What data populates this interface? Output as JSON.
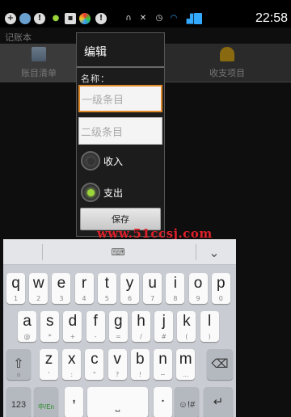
{
  "status_bar": {
    "time": "22:58",
    "icons": [
      "add-icon",
      "globe-icon",
      "alert-icon",
      "android-icon",
      "message-icon",
      "sync-icon",
      "alert-icon",
      "headphones-icon",
      "mute-icon",
      "alarm-icon",
      "wifi-icon",
      "signal-icon",
      "battery-icon"
    ]
  },
  "app": {
    "title": "记账本",
    "tabs": [
      {
        "label": "账目清单",
        "icon": "calculator-icon"
      },
      {
        "label": "收支项目",
        "icon": "money-bag-icon"
      }
    ]
  },
  "dialog": {
    "title": "编辑",
    "name_label": "名称：",
    "level1_placeholder": "一级条目",
    "level2_placeholder": "二级条目",
    "radio_income": "收入",
    "radio_expense": "支出",
    "selected": "支出",
    "save_label": "保存"
  },
  "watermark": "www.51ccsj.com",
  "keyboard": {
    "row1": [
      {
        "main": "q",
        "sub": "1"
      },
      {
        "main": "w",
        "sub": "2"
      },
      {
        "main": "e",
        "sub": "3"
      },
      {
        "main": "r",
        "sub": "4"
      },
      {
        "main": "t",
        "sub": "5"
      },
      {
        "main": "y",
        "sub": "6"
      },
      {
        "main": "u",
        "sub": "7"
      },
      {
        "main": "i",
        "sub": "8"
      },
      {
        "main": "o",
        "sub": "9"
      },
      {
        "main": "p",
        "sub": "0"
      }
    ],
    "row2": [
      {
        "main": "a",
        "sub": "@"
      },
      {
        "main": "s",
        "sub": "*"
      },
      {
        "main": "d",
        "sub": "+"
      },
      {
        "main": "f",
        "sub": "-"
      },
      {
        "main": "g",
        "sub": "="
      },
      {
        "main": "h",
        "sub": "/"
      },
      {
        "main": "j",
        "sub": "#"
      },
      {
        "main": "k",
        "sub": "("
      },
      {
        "main": "l",
        "sub": ")"
      }
    ],
    "row3": [
      {
        "main": "z",
        "sub": "'"
      },
      {
        "main": "x",
        "sub": ":"
      },
      {
        "main": "c",
        "sub": "\""
      },
      {
        "main": "v",
        "sub": "?"
      },
      {
        "main": "b",
        "sub": "!"
      },
      {
        "main": "n",
        "sub": "~"
      },
      {
        "main": "m",
        "sub": "..."
      }
    ],
    "shift_label": "a",
    "numbers_label": "123",
    "lang_label": "中/En",
    "comma_label": ",",
    "period_label": ".",
    "emoji_label": "☺!#",
    "delete_icon": "backspace-icon",
    "enter_icon": "enter-icon",
    "space_icon": "space-icon",
    "hide_icon": "keyboard-hide-icon",
    "collapse_icon": "chevron-down-icon"
  }
}
